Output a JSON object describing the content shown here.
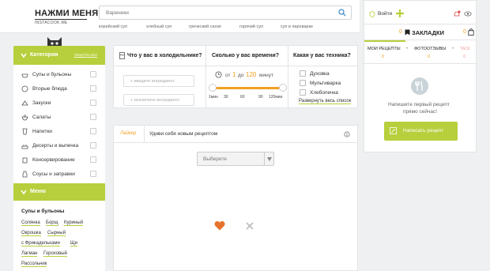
{
  "header": {
    "logo": "НАЖМИ МЕНЯ",
    "logo_sub": "INSTACOOK.ME",
    "search_placeholder": "Вареники",
    "tags": [
      "корейский суп",
      "хлебный суп",
      "греческий салат",
      "горячий суп",
      "суп в пароварке"
    ]
  },
  "sidebar": {
    "categories_title": "Категории",
    "categories_all": "рецепты все",
    "items": [
      {
        "label": "Супы и бульоны",
        "icon": "soup-icon"
      },
      {
        "label": "Вторые блюда",
        "icon": "main-dish-icon"
      },
      {
        "label": "Закуски",
        "icon": "snacks-icon"
      },
      {
        "label": "Салаты",
        "icon": "salad-icon"
      },
      {
        "label": "Напитки",
        "icon": "drinks-icon"
      },
      {
        "label": "Десерты и выпечка",
        "icon": "dessert-icon"
      },
      {
        "label": "Консервирование",
        "icon": "jar-icon"
      },
      {
        "label": "Соусы и заправки",
        "icon": "sauce-icon"
      }
    ],
    "menu_title": "Меню",
    "menu_section": "Супы и бульоны",
    "menu_links": [
      "Солянка",
      "Борщ",
      "Куриный",
      "Окрошка",
      "Сырный",
      "с Фрикадельками",
      "Щи",
      "Лагман",
      "Гороховый",
      "Рассольник"
    ]
  },
  "filters": {
    "fridge_title": "Что у вас в холодильнике?",
    "ingredient_placeholder_1": "+ введите ингредиент",
    "ingredient_placeholder_2": "+ исключите ингредиент",
    "time_title": "Сколько у вас времени?",
    "time_from": "от",
    "time_from_val": "1",
    "time_to": "до",
    "time_to_val": "120",
    "time_unit": "минут",
    "time_ticks": [
      "1мин",
      "30",
      "60",
      "90",
      "120мин"
    ],
    "tech_title": "Какая у вас техника?",
    "tech_items": [
      "Духовка",
      "Мультиварка",
      "Хлебопечка"
    ],
    "tech_expand": "Развернуть весь список"
  },
  "feed": {
    "tab_label": "Лайкер",
    "tab_text": "Удиви себя новым рецептом",
    "select_value": "Выберите"
  },
  "right": {
    "login": "Войти",
    "bookmarks_count": "0",
    "bookmarks_label": "ЗАКЛАДКИ",
    "bag_count": "0",
    "tabs": [
      {
        "label": "МОИ РЕЦЕПТЫ",
        "count": "0"
      },
      {
        "label": "ФОТООТЗЫВЫ",
        "count": "0"
      },
      {
        "label": "ТАСК",
        "count": "0"
      }
    ],
    "empty_text_1": "Напишите первый рецепт",
    "empty_text_2": "прямо сейчас!",
    "write_button": "Написать рецепт"
  },
  "colors": {
    "accent": "#b7cf3c",
    "slider_orange": "#f0a020",
    "heart": "#e8722c"
  }
}
